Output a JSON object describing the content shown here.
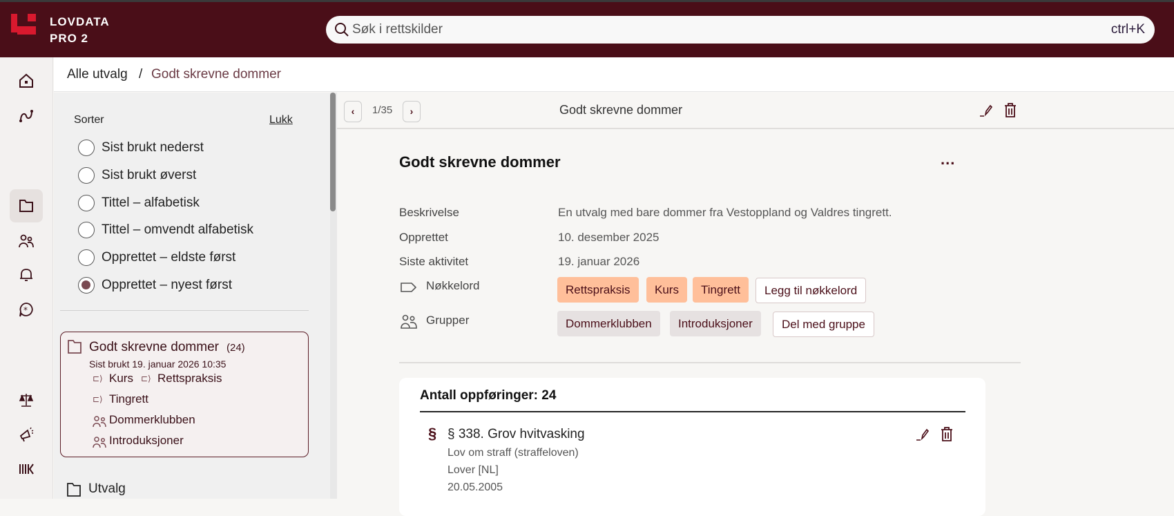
{
  "app": {
    "brand_line1": "LOVDATA",
    "brand_line2": "PRO 2"
  },
  "search": {
    "placeholder": "Søk i rettskilder",
    "shortcut": "ctrl+K"
  },
  "breadcrumb": {
    "root": "Alle utvalg",
    "separator": "/",
    "current": "Godt skrevne dommer"
  },
  "sort": {
    "label": "Sorter",
    "close": "Lukk",
    "options": [
      {
        "label": "Sist brukt nederst",
        "selected": false
      },
      {
        "label": "Sist brukt øverst",
        "selected": false
      },
      {
        "label": "Tittel – alfabetisk",
        "selected": false
      },
      {
        "label": "Tittel – omvendt alfabetisk",
        "selected": false
      },
      {
        "label": "Opprettet – eldste først",
        "selected": false
      },
      {
        "label": "Opprettet – nyest først",
        "selected": true
      }
    ]
  },
  "selection_card": {
    "title": "Godt skrevne dommer",
    "count": "(24)",
    "last_used": "Sist brukt 19. januar 2026 10:35",
    "keywords": [
      "Kurs",
      "Rettspraksis",
      "Tingrett"
    ],
    "groups": [
      "Dommerklubben",
      "Introduksjoner"
    ]
  },
  "other_folder": "Utvalg",
  "toolbar": {
    "page": "1/35",
    "title": "Godt skrevne dommer"
  },
  "detail": {
    "title": "Godt skrevne dommer",
    "more": "...",
    "description_label": "Beskrivelse",
    "description": "En utvalg med bare dommer fra Vestoppland og Valdres tingrett.",
    "created_label": "Opprettet",
    "created": "10. desember 2025",
    "activity_label": "Siste aktivitet",
    "activity": "19. januar 2026",
    "keywords_label": "Nøkkelord",
    "keywords": [
      "Rettspraksis",
      "Kurs",
      "Tingrett"
    ],
    "add_keyword": "Legg til nøkkelord",
    "groups_label": "Grupper",
    "groups": [
      "Dommerklubben",
      "Introduksjoner"
    ],
    "share_group": "Del med gruppe"
  },
  "entries": {
    "count_label": "Antall oppføringer: 24",
    "items": [
      {
        "symbol": "§",
        "title": "§ 338. Grov hvitvasking",
        "law": "Lov om straff (straffeloven)",
        "type": "Lover [NL]",
        "date": "20.05.2005"
      }
    ]
  },
  "colors": {
    "brand": "#4a0e18",
    "keyword_chip": "#ffbf9a",
    "group_chip": "#e6e1e1"
  }
}
